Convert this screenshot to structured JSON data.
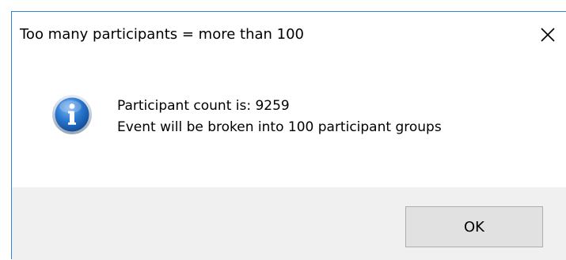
{
  "dialog": {
    "title": "Too many participants = more than 100",
    "close_icon": "close-icon",
    "icon": "info-icon",
    "message_line1": "Participant count is: 9259",
    "message_line2": "Event will be broken into 100 participant groups",
    "ok_label": "OK"
  },
  "colors": {
    "window_border": "#2f86d6",
    "footer_bg": "#f0f0f0",
    "button_bg": "#e1e1e1",
    "button_border": "#adadad",
    "info_icon_blue": "#1f6fc5"
  }
}
